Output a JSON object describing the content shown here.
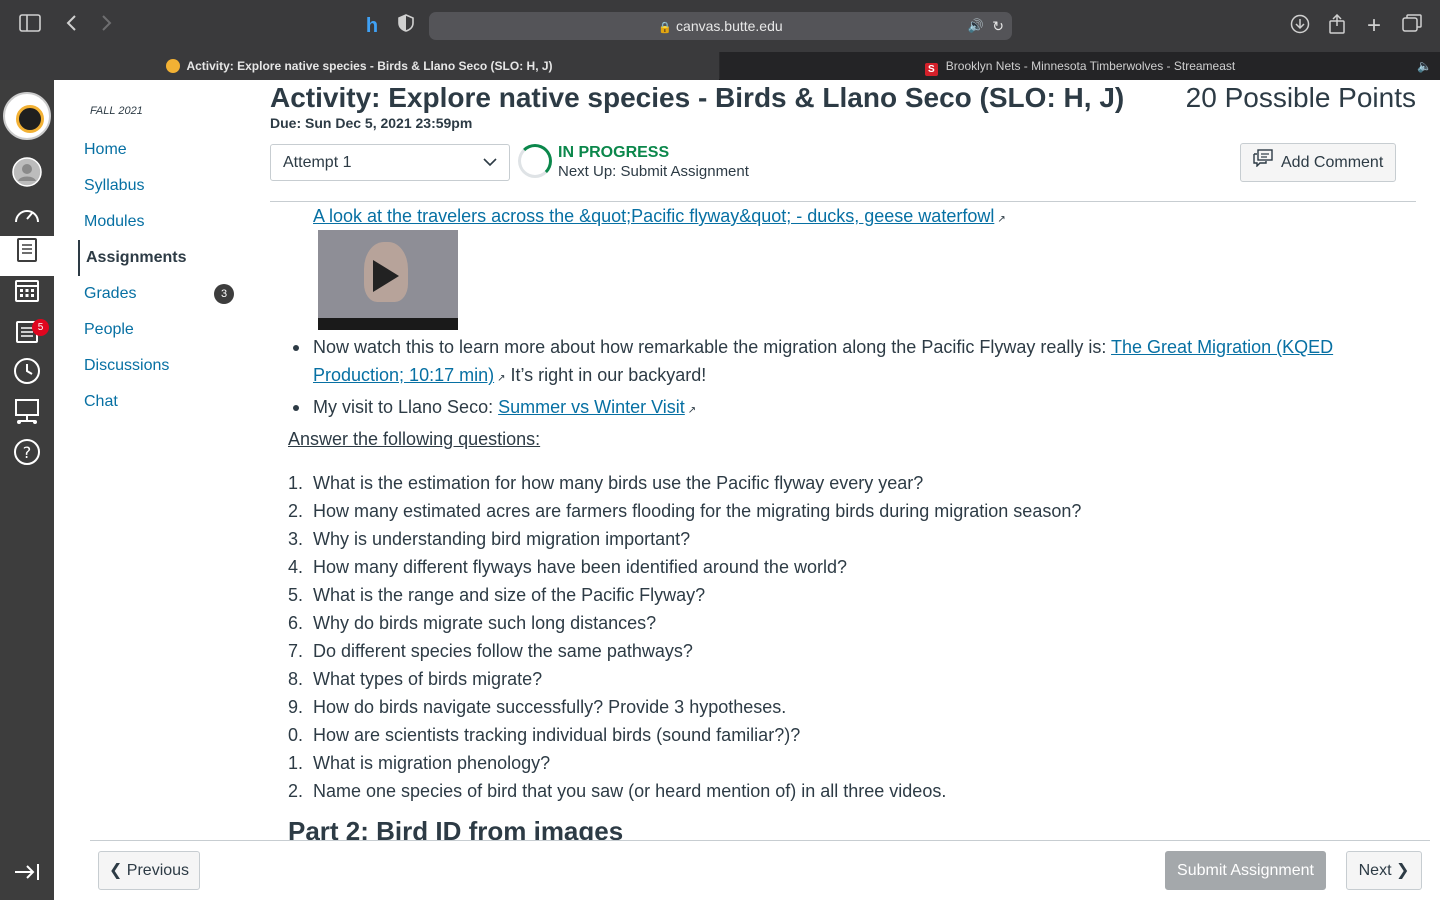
{
  "browser": {
    "url": "canvas.butte.edu",
    "tabs": [
      {
        "label": "Activity: Explore native species - Birds & Llano Seco (SLO: H, J)"
      },
      {
        "label": "Brooklyn Nets - Minnesota Timberwolves - Streameast"
      }
    ],
    "icons": {
      "sidebar": "sidebar-icon",
      "back": "back-icon",
      "forward": "forward-icon",
      "extension": "honey-icon",
      "shield": "shield-icon",
      "lock": "lock-icon",
      "audio": "speaker-icon",
      "reload": "reload-icon",
      "download": "download-icon",
      "share": "share-icon",
      "new_tab": "plus-icon",
      "tabs": "tabs-icon"
    },
    "tab_favicon_letter": "S"
  },
  "global_nav": {
    "items": [
      "account",
      "dashboard",
      "courses",
      "calendar",
      "inbox",
      "history",
      "commons",
      "help"
    ],
    "inbox_badge": "5"
  },
  "course_nav": {
    "term": "FALL 2021",
    "items": [
      {
        "label": "Home"
      },
      {
        "label": "Syllabus"
      },
      {
        "label": "Modules"
      },
      {
        "label": "Assignments"
      },
      {
        "label": "Grades"
      },
      {
        "label": "People"
      },
      {
        "label": "Discussions"
      },
      {
        "label": "Chat"
      }
    ],
    "grades_badge": "3"
  },
  "assignment": {
    "title": "Activity: Explore native species - Birds & Llano Seco (SLO: H, J)",
    "points": "20 Possible Points",
    "due": "Due: Sun Dec 5, 2021 23:59pm",
    "attempt": "Attempt 1",
    "status": "IN PROGRESS",
    "next_up": "Next Up: Submit Assignment",
    "add_comment": "Add Comment"
  },
  "content": {
    "video_link": "A look at the travelers across the &quot;Pacific flyway&quot; - ducks, geese waterfowl",
    "bullet1_text": "Now watch this to learn more about how remarkable the migration along the Pacific Flyway really is: ",
    "bullet1_link": "The Great Migration (KQED Production; 10:17 min)",
    "bullet1_after": " It’s right in our backyard!",
    "bullet2_text": "My visit to Llano Seco: ",
    "bullet2_link": "Summer vs Winter Visit",
    "answer_heading": "Answer the following questions:",
    "questions": [
      {
        "num": "1.",
        "text": "What is the estimation for how many birds use the Pacific flyway every year?"
      },
      {
        "num": "2.",
        "text": "How many estimated acres are farmers flooding for the migrating birds during migration season?"
      },
      {
        "num": "3.",
        "text": "Why is understanding bird migration important?"
      },
      {
        "num": "4.",
        "text": "How many different flyways have been identified around the world?"
      },
      {
        "num": "5.",
        "text": "What is the range and size of the Pacific Flyway?"
      },
      {
        "num": "6.",
        "text": "Why do birds migrate such long distances?"
      },
      {
        "num": "7.",
        "text": "Do different species follow the same pathways?"
      },
      {
        "num": "8.",
        "text": "What types of birds migrate?"
      },
      {
        "num": "9.",
        "text": "How do birds navigate successfully? Provide 3 hypotheses."
      },
      {
        "num": "0.",
        "text": "How are scientists tracking individual birds (sound familiar?)?"
      },
      {
        "num": "1.",
        "text": "What is migration phenology?"
      },
      {
        "num": "2.",
        "text": "Name one species of bird that you saw (or heard mention of) in all three videos."
      }
    ],
    "part2": "Part 2: Bird ID from images"
  },
  "footer": {
    "previous": "Previous",
    "submit": "Submit Assignment",
    "next": "Next"
  }
}
